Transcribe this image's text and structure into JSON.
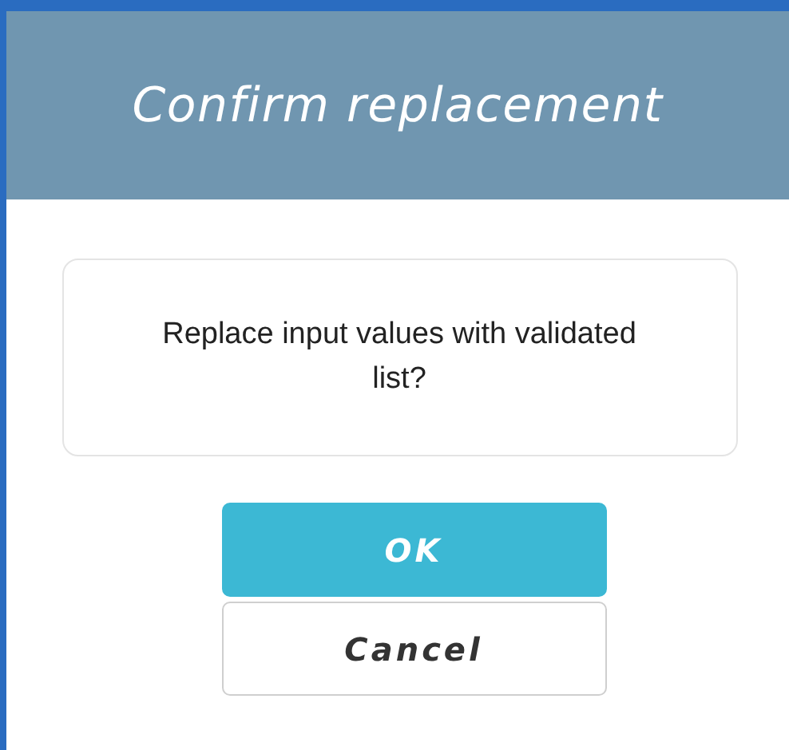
{
  "dialog": {
    "title": "Confirm replacement",
    "message": "Replace input values with validated list?",
    "buttons": [
      {
        "label": "OK",
        "kind": "primary"
      },
      {
        "label": "Cancel",
        "kind": "secondary"
      }
    ]
  }
}
